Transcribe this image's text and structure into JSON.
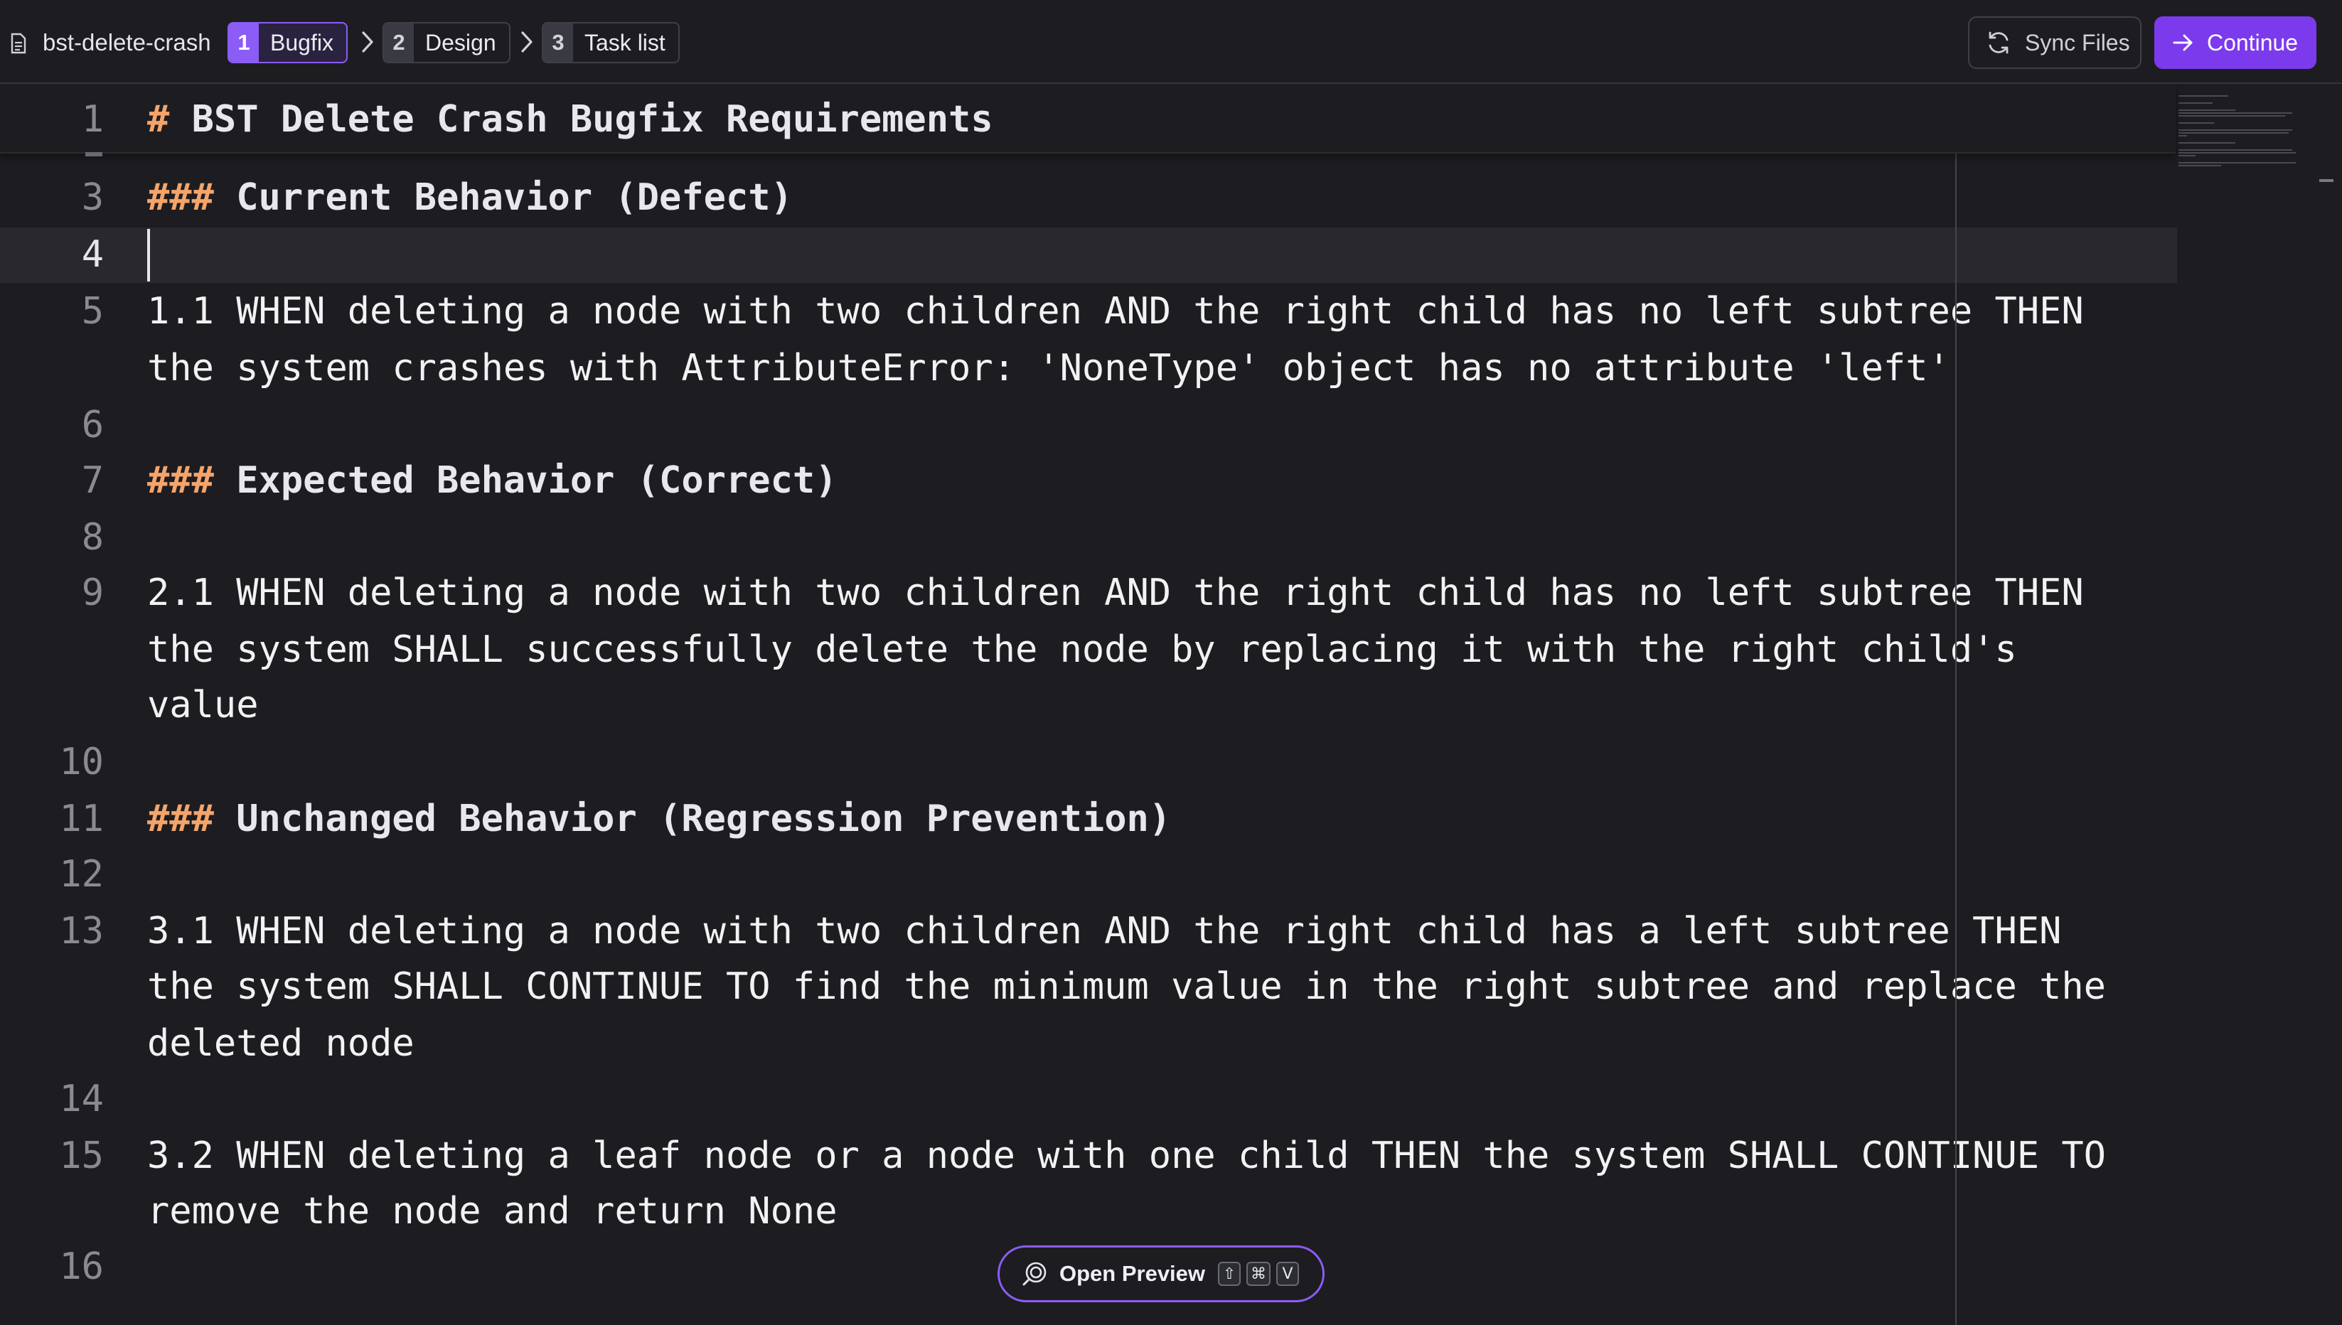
{
  "header": {
    "spec_name": "bst-delete-crash",
    "steps": [
      {
        "num": "1",
        "label": "Bugfix"
      },
      {
        "num": "2",
        "label": "Design"
      },
      {
        "num": "3",
        "label": "Task list"
      }
    ],
    "sync_label": "Sync Files",
    "continue_label": "Continue"
  },
  "editor": {
    "sticky": {
      "num": "1",
      "hash": "#",
      "text": " BST Delete Crash Bugfix Requirements"
    },
    "lines": [
      {
        "num": "3",
        "hash": "###",
        "text": " Current Behavior (Defect)"
      },
      {
        "num": "4",
        "text": ""
      },
      {
        "num": "5",
        "text": "1.1 WHEN deleting a node with two children AND the right child has no left subtree THEN"
      },
      {
        "num": "",
        "text": "the system crashes with AttributeError: 'NoneType' object has no attribute 'left'"
      },
      {
        "num": "6",
        "text": ""
      },
      {
        "num": "7",
        "hash": "###",
        "text": " Expected Behavior (Correct)"
      },
      {
        "num": "8",
        "text": ""
      },
      {
        "num": "9",
        "text": "2.1 WHEN deleting a node with two children AND the right child has no left subtree THEN"
      },
      {
        "num": "",
        "text": "the system SHALL successfully delete the node by replacing it with the right child's"
      },
      {
        "num": "",
        "text": "value"
      },
      {
        "num": "10",
        "text": ""
      },
      {
        "num": "11",
        "hash": "###",
        "text": " Unchanged Behavior (Regression Prevention)"
      },
      {
        "num": "12",
        "text": ""
      },
      {
        "num": "13",
        "text": "3.1 WHEN deleting a node with two children AND the right child has a left subtree THEN"
      },
      {
        "num": "",
        "text": "the system SHALL CONTINUE TO find the minimum value in the right subtree and replace the"
      },
      {
        "num": "",
        "text": "deleted node"
      },
      {
        "num": "14",
        "text": ""
      },
      {
        "num": "15",
        "text": "3.2 WHEN deleting a leaf node or a node with one child THEN the system SHALL CONTINUE TO"
      },
      {
        "num": "",
        "text": "remove the node and return None"
      },
      {
        "num": "16",
        "text": ""
      }
    ]
  },
  "preview": {
    "label": "Open Preview",
    "keys": [
      "⇧",
      "⌘",
      "V"
    ]
  },
  "colors": {
    "accent": "#7c3aed",
    "heading_hash": "#f5a46a",
    "background": "#1d1d21"
  },
  "icons": {
    "file": "file-icon",
    "chevron": "chevron-right-icon",
    "sync": "sync-icon",
    "continue": "arrow-right-icon",
    "preview": "preview-icon"
  }
}
